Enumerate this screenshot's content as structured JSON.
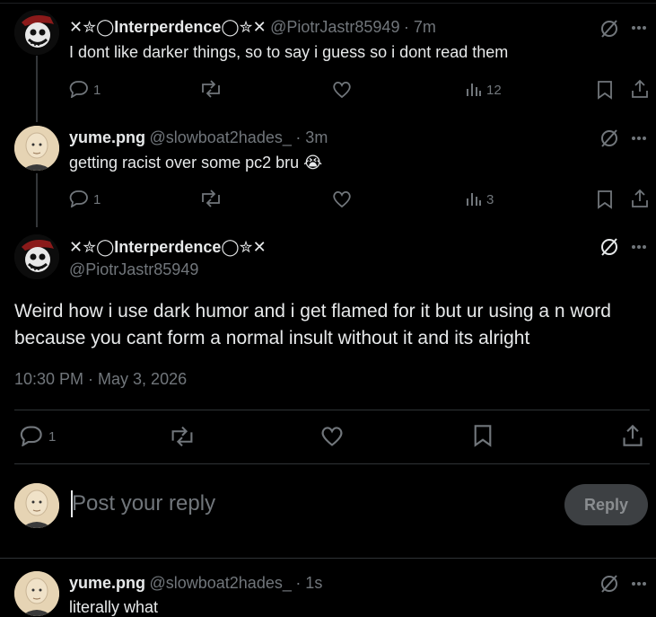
{
  "tweets": [
    {
      "name": "✕✮◯Interperdence◯✮✕",
      "handle": "@PiotrJastr85949",
      "time": "· 7m",
      "text": "I dont like darker things, so to say i guess so i dont read them",
      "replies": "1",
      "views": "12"
    },
    {
      "name": "yume.png",
      "handle": "@slowboat2hades_",
      "time": "· 3m",
      "text": "getting racist over some pc2 bru 😭",
      "replies": "1",
      "views": "3"
    }
  ],
  "main": {
    "name": "✕✮◯Interperdence◯✮✕",
    "handle": "@PiotrJastr85949",
    "text": "Weird how i use dark humor and i get flamed for it but ur using a n word because you cant form a normal insult without it and its alright",
    "timestamp": "10:30 PM · May 3, 2026",
    "replies": "1"
  },
  "reply_box": {
    "placeholder": "Post your reply",
    "button": "Reply"
  },
  "bottom_tweet": {
    "name": "yume.png",
    "handle": "@slowboat2hades_",
    "time": "· 1s",
    "text": "literally what"
  },
  "colors": {
    "background": "#000000",
    "text": "#e7e9ea",
    "muted": "#71767b",
    "divider": "#2f3336"
  }
}
